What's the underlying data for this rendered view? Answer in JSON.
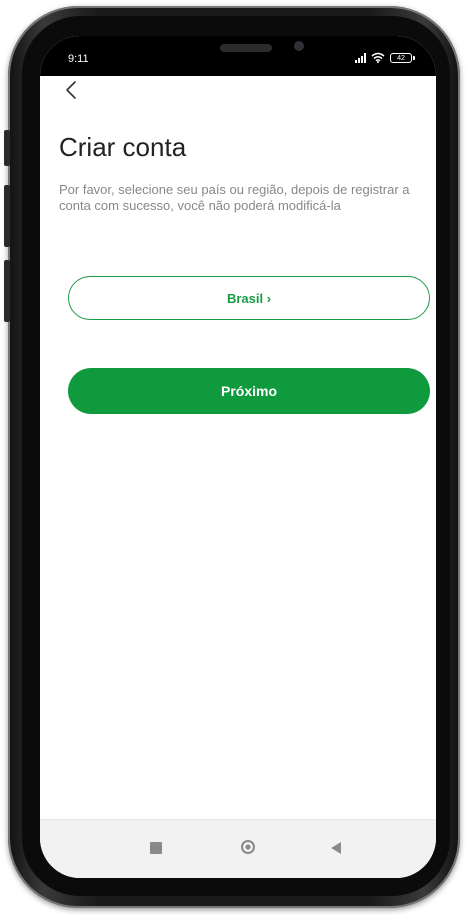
{
  "status_bar": {
    "time": "9:11",
    "battery": "42",
    "icons": [
      "signal-icon",
      "wifi-icon",
      "battery-icon"
    ]
  },
  "header": {
    "back_icon": "chevron-left-icon",
    "title": "Criar conta"
  },
  "main": {
    "description": "Por favor, selecione seu país ou região, depois de registrar a conta com sucesso, você não poderá modificá-la",
    "country_label": "Brasil ›",
    "next_label": "Próximo"
  },
  "nav_bar": {
    "icons": [
      "recent-apps-icon",
      "home-icon",
      "back-icon"
    ]
  },
  "colors": {
    "accent": "#0f9a3e",
    "title": "#222222",
    "description": "#888888"
  }
}
